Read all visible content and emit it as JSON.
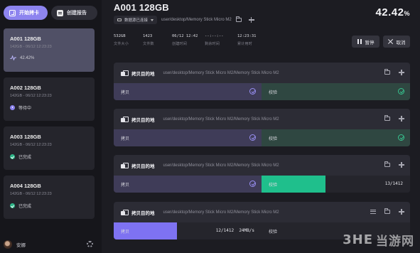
{
  "sidebar": {
    "start_button": "开始拷卡",
    "create_button": "创建报告",
    "tasks": [
      {
        "title": "A001 128GB",
        "meta": "142GB - 06/12 12:23:23",
        "status": "42.42%",
        "status_kind": "progress"
      },
      {
        "title": "A002 128GB",
        "meta": "142GB - 06/12 12:23:23",
        "status": "等待中",
        "status_kind": "waiting"
      },
      {
        "title": "A003 128GB",
        "meta": "142GB - 06/12 12:23:23",
        "status": "已完成",
        "status_kind": "done"
      },
      {
        "title": "A004 128GB",
        "meta": "142GB - 06/12 12:23:23",
        "status": "已完成",
        "status_kind": "done"
      }
    ],
    "user_name": "安娜"
  },
  "header": {
    "title": "A001 128GB",
    "percent_value": "42.42",
    "percent_sign": "%",
    "source_dropdown": "数据源已连接",
    "source_path": "user/desktop/Memory Stick Micro M2"
  },
  "stats": [
    {
      "value": "532GB",
      "label": "文件大小"
    },
    {
      "value": "1423",
      "label": "文件数"
    },
    {
      "value": "06/12 12:42",
      "label": "创建时间"
    },
    {
      "value": "--:--:--",
      "label": "剩余时间"
    },
    {
      "value": "12:23:31",
      "label": "累计用时"
    }
  ],
  "controls": {
    "pause": "暂停",
    "cancel": "取消"
  },
  "panels": [
    {
      "label": "拷贝目的地",
      "path": "user/desktop/Memory Stick Micro M2/Memory Stick Micro M2",
      "copy_label": "拷贝",
      "verify_label": "校验",
      "copy_count": "",
      "copy_speed": "",
      "verify_count": ""
    },
    {
      "label": "拷贝目的地",
      "path": "user/desktop/Memory Stick Micro M2/Memory Stick Micro M2",
      "copy_label": "拷贝",
      "verify_label": "校验",
      "copy_count": "",
      "copy_speed": "",
      "verify_count": ""
    },
    {
      "label": "拷贝目的地",
      "path": "user/desktop/Memory Stick Micro M2/Memory Stick Micro M2",
      "copy_label": "拷贝",
      "verify_label": "校验",
      "copy_count": "",
      "copy_speed": "",
      "verify_count": "13/1412"
    },
    {
      "label": "拷贝目的地",
      "path": "user/desktop/Memory Stick Micro M2/Memory Stick Micro M2",
      "copy_label": "拷贝",
      "verify_label": "校验",
      "copy_count": "12/1412",
      "copy_speed": "24MB/s",
      "verify_count": ""
    }
  ],
  "watermark": {
    "logo": "3HE",
    "text": "当游网"
  },
  "colors": {
    "accent_purple": "#8d84ef",
    "accent_green": "#2fb689",
    "copy_done_bg": "#3f3c58",
    "verify_done_bg": "#2f4741",
    "verify_active": "#1fbf8c",
    "copy_active": "#7e72f2"
  }
}
